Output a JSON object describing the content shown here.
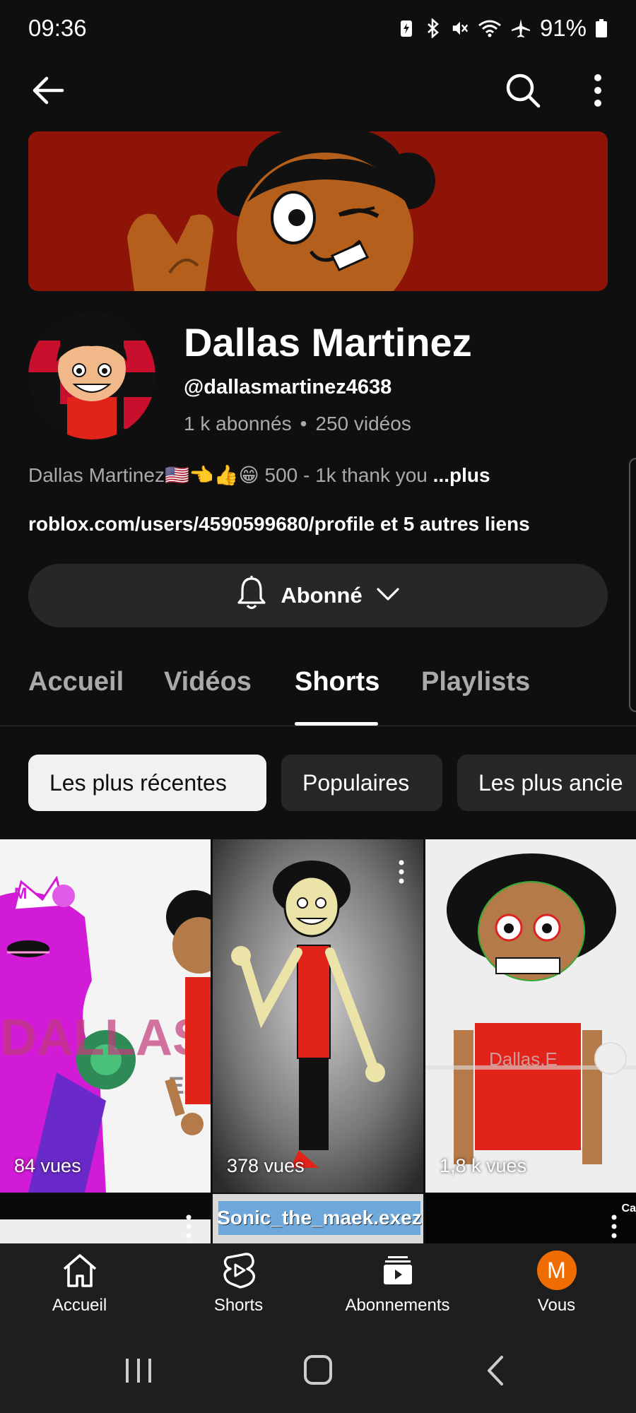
{
  "status_bar": {
    "time": "09:36",
    "battery": "91%",
    "icons": [
      "battery-saver-icon",
      "bluetooth-icon",
      "mute-icon",
      "wifi-icon",
      "airplane-icon",
      "battery-icon"
    ]
  },
  "top_bar": {
    "icons": [
      "back-arrow-icon",
      "search-icon",
      "more-vert-icon"
    ]
  },
  "channel": {
    "name": "Dallas Martinez",
    "handle": "@dallasmartinez4638",
    "subscribers": "1 k abonnés",
    "separator": "•",
    "videos": "250 vidéos",
    "description": "Dallas Martinez🇺🇸👈👍😁 500 - 1k thank you",
    "description_more": "...plus",
    "link": "roblox.com/users/4590599680/profile",
    "link_extra": "et 5 autres liens"
  },
  "subscribe_button": {
    "label": "Abonné",
    "icons": [
      "bell-icon",
      "chevron-down-icon"
    ]
  },
  "tabs": [
    {
      "label": "Accueil",
      "active": false
    },
    {
      "label": "Vidéos",
      "active": false
    },
    {
      "label": "Shorts",
      "active": true
    },
    {
      "label": "Playlists",
      "active": false
    }
  ],
  "chips": [
    {
      "label": "Les plus récentes",
      "active": true
    },
    {
      "label": "Populaires",
      "active": false
    },
    {
      "label": "Les plus ancie",
      "active": false
    }
  ],
  "shorts": [
    {
      "views": "84 vues",
      "overlay_text": "DALLAS",
      "overlay_text2": "EZ"
    },
    {
      "views": "378 vues"
    },
    {
      "views": "1,8 k vues",
      "overlay_text": "Dallas.E"
    }
  ],
  "shorts_row2": {
    "middle_title": "Sonic_the_maek.exez",
    "right_label": "Ca"
  },
  "bottom_nav": [
    {
      "label": "Accueil",
      "icon": "home-icon"
    },
    {
      "label": "Shorts",
      "icon": "shorts-icon"
    },
    {
      "label": "Abonnements",
      "icon": "subscriptions-icon"
    },
    {
      "label": "Vous",
      "icon": "account-avatar",
      "avatar_letter": "M"
    }
  ],
  "colors": {
    "background": "#0f0f0f",
    "banner_red": "#8f1408",
    "chip_active": "#f1f1f1",
    "avatar_orange": "#ef6c00"
  }
}
